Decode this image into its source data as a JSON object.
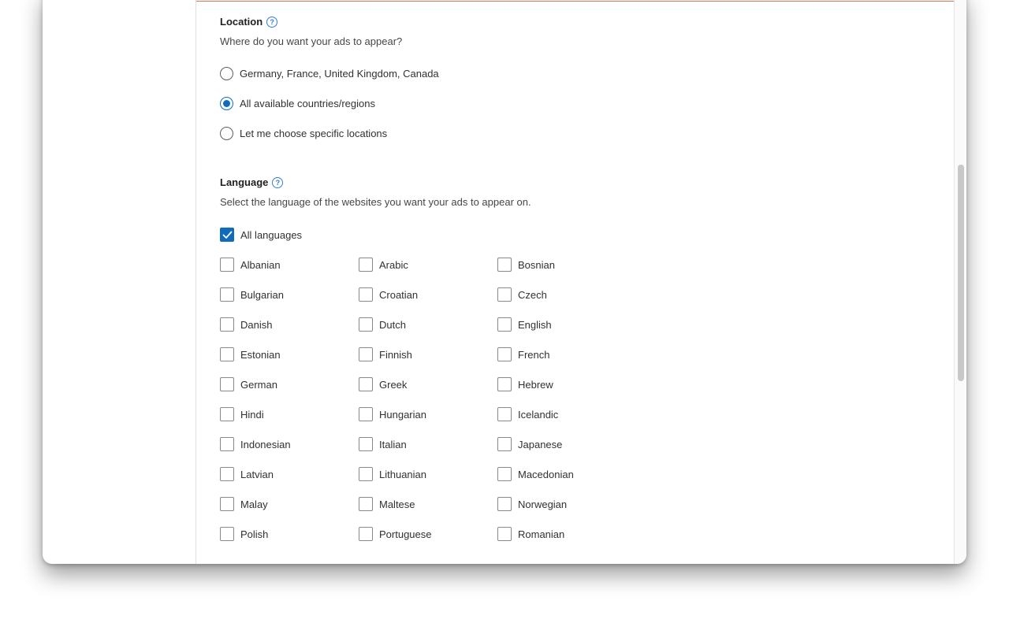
{
  "location": {
    "title": "Location",
    "description": "Where do you want your ads to appear?",
    "options": [
      {
        "label": "Germany, France, United Kingdom, Canada",
        "checked": false
      },
      {
        "label": "All available countries/regions",
        "checked": true
      },
      {
        "label": "Let me choose specific locations",
        "checked": false
      }
    ]
  },
  "language": {
    "title": "Language",
    "description": "Select the language of the websites you want your ads to appear on.",
    "all_label": "All languages",
    "all_checked": true,
    "items": [
      "Albanian",
      "Arabic",
      "Bosnian",
      "Bulgarian",
      "Croatian",
      "Czech",
      "Danish",
      "Dutch",
      "English",
      "Estonian",
      "Finnish",
      "French",
      "German",
      "Greek",
      "Hebrew",
      "Hindi",
      "Hungarian",
      "Icelandic",
      "Indonesian",
      "Italian",
      "Japanese",
      "Latvian",
      "Lithuanian",
      "Macedonian",
      "Malay",
      "Maltese",
      "Norwegian",
      "Polish",
      "Portuguese",
      "Romanian"
    ]
  },
  "help_glyph": "?",
  "colors": {
    "accent": "#0f6cbd",
    "help": "#2e7fd8",
    "top_border": "#d9735a"
  }
}
